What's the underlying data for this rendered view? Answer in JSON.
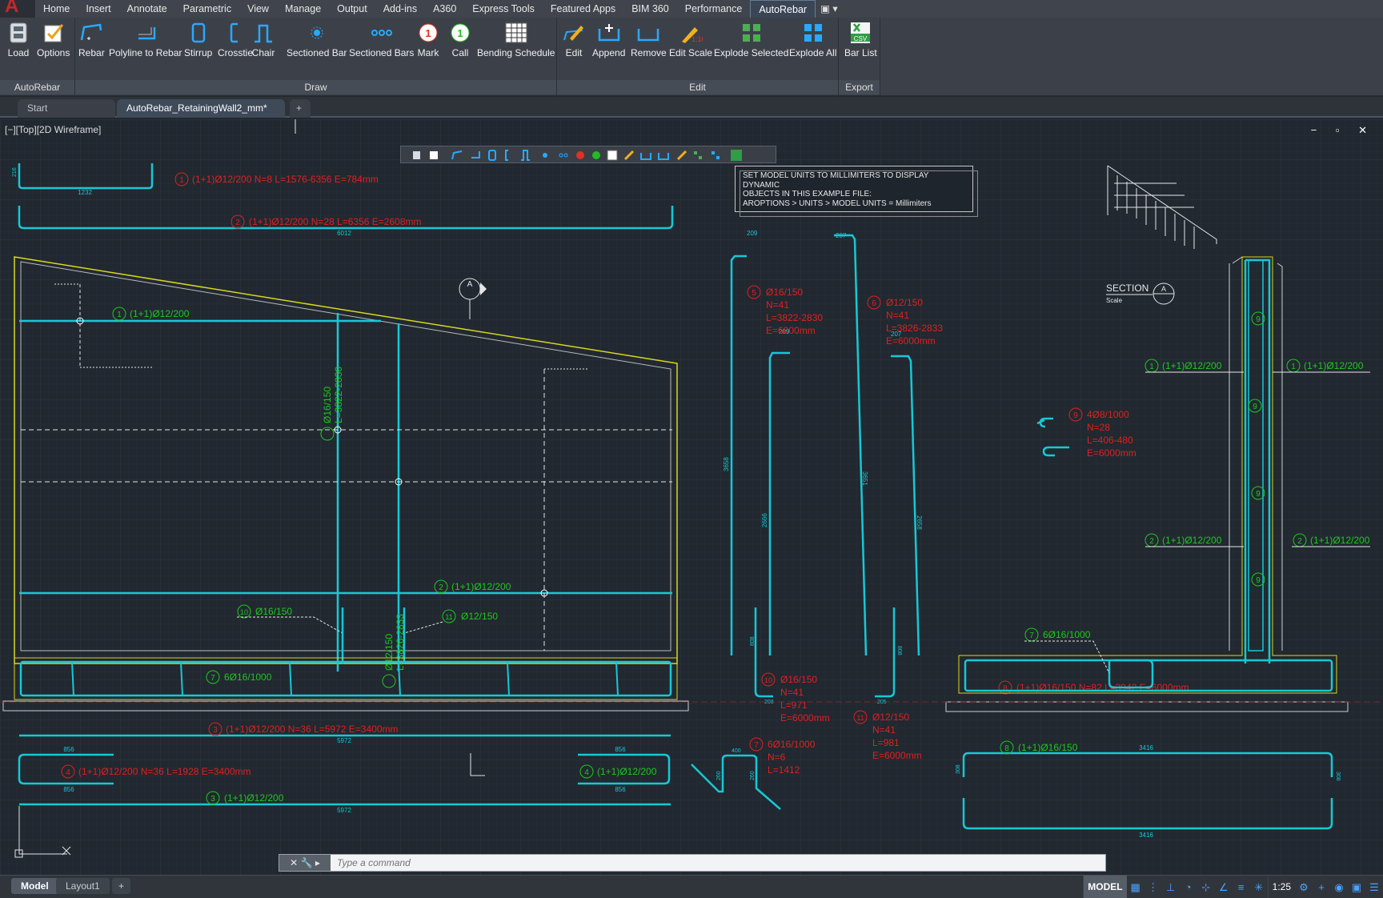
{
  "menu": {
    "tabs": [
      "Home",
      "Insert",
      "Annotate",
      "Parametric",
      "View",
      "Manage",
      "Output",
      "Add-ins",
      "A360",
      "Express Tools",
      "Featured Apps",
      "BIM 360",
      "Performance",
      "AutoRebar"
    ],
    "active": "AutoRebar",
    "extra": "▣ ▾"
  },
  "ribbon": {
    "panels": {
      "autorebar": "AutoRebar",
      "draw": "Draw",
      "edit": "Edit",
      "export": "Export"
    },
    "buttons": {
      "load": "Load",
      "options": "Options",
      "rebar": "Rebar",
      "polyline_to_rebar": "Polyline to Rebar",
      "stirrup": "Stirrup",
      "crosstie": "Crosstie",
      "chair": "Chair",
      "sectioned_bar": "Sectioned Bar",
      "sectioned_bars": "Sectioned Bars",
      "mark": "Mark",
      "call": "Call",
      "bending_schedule": "Bending Schedule",
      "edit": "Edit",
      "append": "Append",
      "remove": "Remove",
      "edit_scale": "Edit Scale",
      "explode_selected": "Explode Selected",
      "explode_all": "Explode All",
      "bar_list": "Bar List"
    },
    "icon_labels": {
      "mark": "1",
      "call": "1",
      "csv": "CSV",
      "scale": "1:10"
    }
  },
  "doctabs": {
    "start": "Start",
    "file": "AutoRebar_RetainingWall2_mm*",
    "close": "✕",
    "new": "+"
  },
  "viewport": {
    "label": "[−][Top][2D Wireframe]",
    "controls": "− ▫ ✕"
  },
  "note": {
    "line1": "SET MODEL UNITS TO MILLIMITERS TO DISPLAY DYNAMIC",
    "line2": "OBJECTS IN THIS EXAMPLE FILE:",
    "line3": "AROPTIONS > UNITS > MODEL UNITS = Millimiters"
  },
  "drawing": {
    "bars": [
      {
        "n": "1",
        "text": "(1+1)Ø12/200  N=8  L=1576-6356  E=784mm"
      },
      {
        "n": "2",
        "text": "(1+1)Ø12/200  N=28  L=6356  E=2608mm"
      },
      {
        "n": "3",
        "text": "(1+1)Ø12/200  N=36  L=5972  E=3400mm"
      },
      {
        "n": "4",
        "text": "(1+1)Ø12/200  N=36  L=1928  E=3400mm"
      },
      {
        "n": "8",
        "text": "(1+1)Ø16/150  N=82  L=3942  E=6000mm"
      }
    ],
    "callouts": {
      "c1": "(1+1)Ø12/200",
      "c2": "(1+1)Ø12/200",
      "c3": "(1+1)Ø12/200",
      "c4": "(1+1)Ø12/200",
      "c5": "Ø16/150",
      "c5b": "L=3822-2830",
      "c6": "Ø12/150",
      "c6b": "L=3826-2833",
      "c7": "6Ø16/1000",
      "c8": "(1+1)Ø16/150",
      "c10": "Ø16/150",
      "c11": "Ø12/150",
      "s1": "(1+1)Ø12/200",
      "s2": "(1+1)Ø12/200",
      "s7": "6Ø16/1000"
    },
    "rebar_tags": {
      "r5": [
        "Ø16/150",
        "N=41",
        "L=3822-2830",
        "E=6000mm"
      ],
      "r6": [
        "Ø12/150",
        "N=41",
        "L=3826-2833",
        "E=6000mm"
      ],
      "r9": [
        "4Ø8/1000",
        "N=28",
        "L=406-480",
        "E=6000mm"
      ],
      "r10": [
        "Ø16/150",
        "N=41",
        "L=971",
        "E=6000mm"
      ],
      "r11": [
        "Ø12/150",
        "N=41",
        "L=981",
        "E=6000mm"
      ],
      "r7": [
        "6Ø16/1000",
        "N=6",
        "L=1412"
      ]
    },
    "dims": {
      "d1232": "1232",
      "d6012": "6012",
      "d216": "216",
      "d5972": "5972",
      "d856": "856",
      "d209": "209",
      "d207": "207",
      "d3658": "3658",
      "d3651": "3651",
      "d2666": "2666",
      "d2658": "2658",
      "d808": "808",
      "d208": "208",
      "d205": "205",
      "d400": "400",
      "d260": "260",
      "d3416": "3416",
      "d308": "308"
    },
    "section": {
      "title": "SECTION",
      "scale": "Scale",
      "letter": "A"
    },
    "marker": "A",
    "circle9": "9"
  },
  "command": {
    "placeholder": "Type a command",
    "tools": "✕ 🔧 ▸"
  },
  "layouts": {
    "model": "Model",
    "layout1": "Layout1",
    "add": "+"
  },
  "status": {
    "model": "MODEL",
    "scale": "1:25"
  },
  "colors": {
    "cyan": "#15c9d6",
    "red": "#e02020",
    "green": "#1ec81e",
    "yellow": "#d8d81e",
    "white": "#ffffff",
    "accent": "#4aa3ff"
  }
}
